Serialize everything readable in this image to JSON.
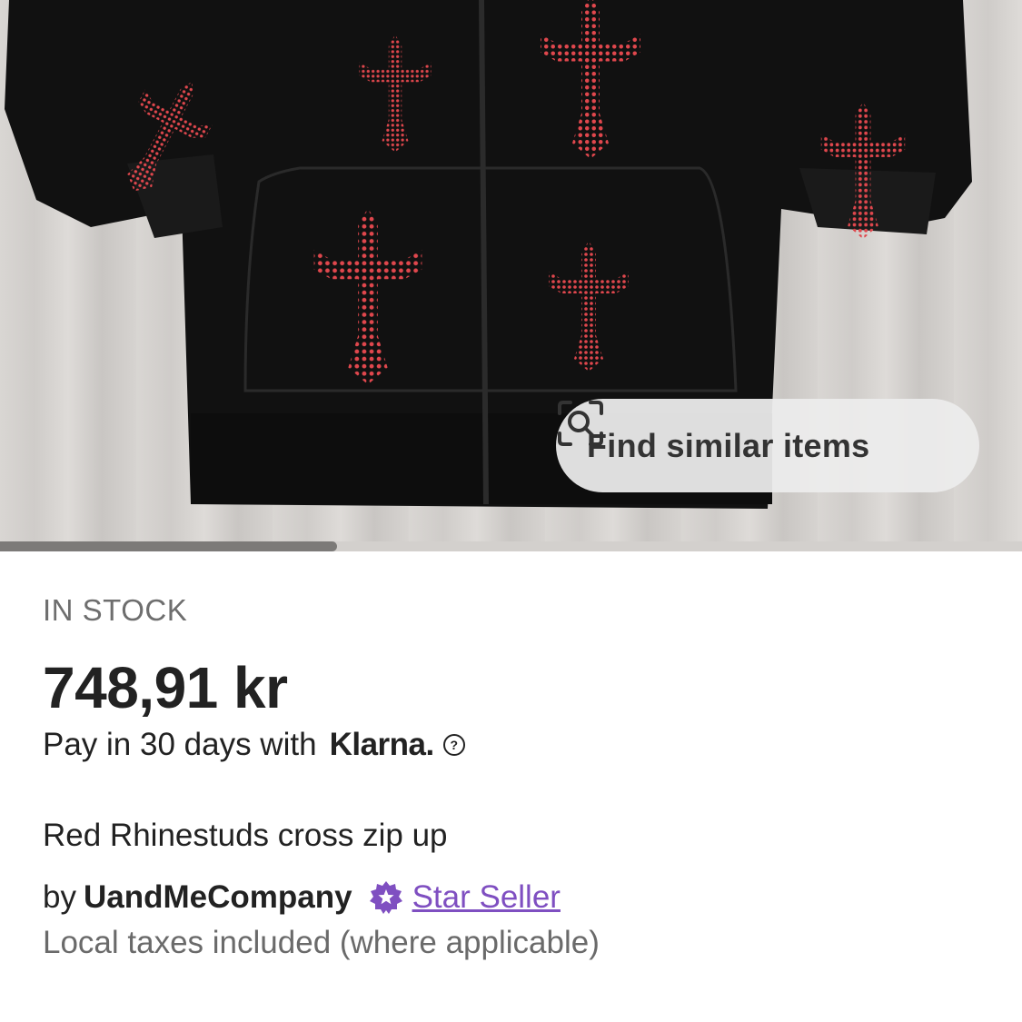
{
  "product_image": {
    "alt": "Black zip-up hoodie with red rhinestone crosses",
    "image_progress": 0.33
  },
  "find_similar": {
    "label": "Find similar items",
    "icon": "visual-search-icon"
  },
  "listing": {
    "stock_status": "IN STOCK",
    "price": "748,91 kr",
    "klarna_text": "Pay in 30 days with",
    "klarna_brand": "Klarna.",
    "klarna_help_icon": "help-circle-icon",
    "title": "Red Rhinestuds cross zip up",
    "seller_prefix": "by",
    "shop_name": "UandMeCompany",
    "star_seller_label": "Star Seller",
    "star_seller_icon": "star-badge-icon",
    "taxes_note": "Local taxes included (where applicable)"
  },
  "colors": {
    "star_seller": "#7f4fc1",
    "cross_red": "#d9393f",
    "hoodie_black": "#111111"
  }
}
